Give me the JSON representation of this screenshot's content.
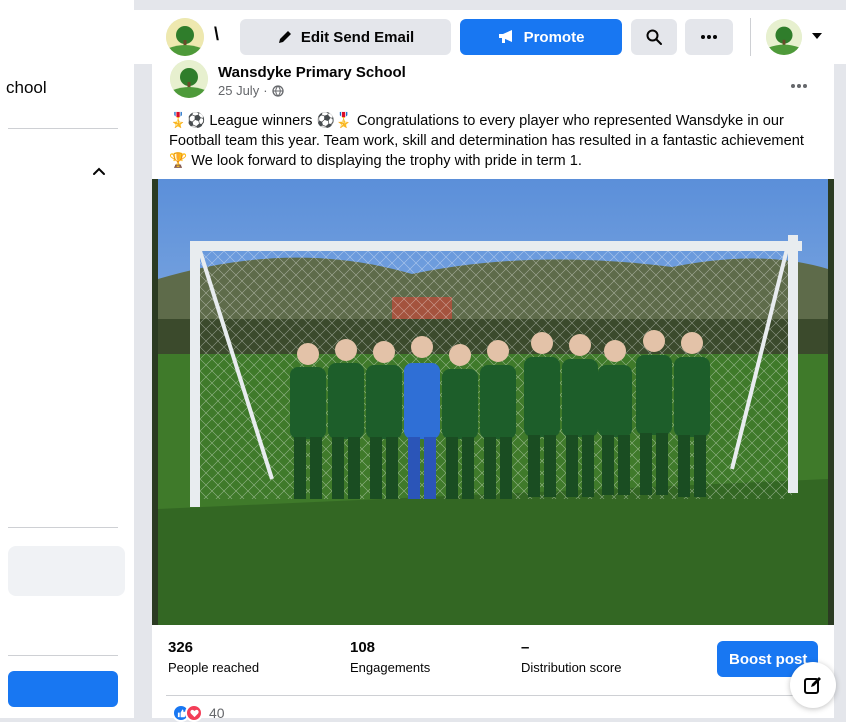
{
  "sidebar": {
    "title_fragment": "chool"
  },
  "topbar": {
    "back_text": "\\",
    "edit_label": "Edit Send Email",
    "promote_label": "Promote"
  },
  "post": {
    "author": "Wansdyke Primary School",
    "date": "25 July",
    "separator": "·",
    "text": "🎖️⚽ League winners ⚽🎖️ Congratulations to every player who represented Wansdyke in our Football team this year. Team work, skill and determination has resulted in a fantastic achievement 🏆 We look forward to displaying the trophy with pride in term 1."
  },
  "stats": [
    {
      "value": "326",
      "label": "People reached"
    },
    {
      "value": "108",
      "label": "Engagements"
    },
    {
      "value": "–",
      "label": "Distribution score"
    }
  ],
  "boost_label": "Boost post",
  "reactions": {
    "count": "40"
  },
  "colors": {
    "brand_blue": "#1877f2",
    "grey_button": "#e4e6eb",
    "secondary_text": "#65676b"
  },
  "icons": {
    "edit": "pencil-icon",
    "promote": "megaphone-icon",
    "search": "search-icon",
    "more": "more-icon",
    "visibility": "globe-icon",
    "compose": "compose-icon"
  }
}
